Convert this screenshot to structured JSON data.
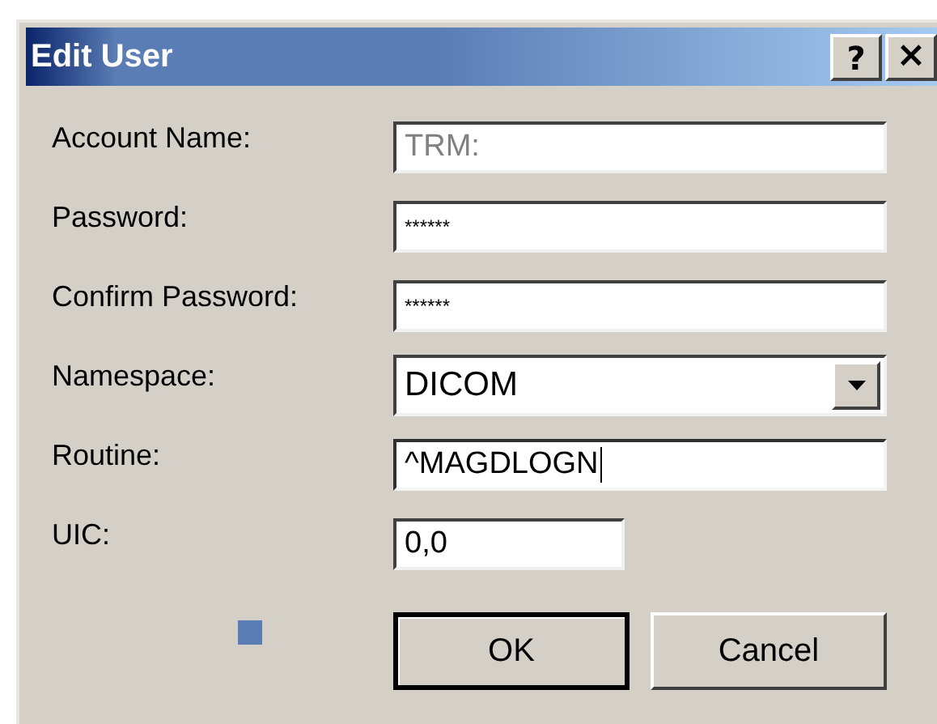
{
  "window": {
    "title": "Edit User",
    "title_buttons": [
      {
        "kind": "help",
        "label": "?"
      },
      {
        "kind": "close",
        "label": "×"
      }
    ]
  },
  "fields": [
    {
      "kind": "text",
      "label": "Account Name:",
      "value": "TRM:",
      "disabled": true,
      "focused": false
    },
    {
      "kind": "password",
      "label": "Password:",
      "value": "******",
      "disabled": false,
      "focused": false
    },
    {
      "kind": "password",
      "label": "Confirm Password:",
      "value": "******",
      "disabled": false,
      "focused": false
    },
    {
      "kind": "combo",
      "label": "Namespace:",
      "value": "DICOM",
      "disabled": false,
      "focused": false
    },
    {
      "kind": "text",
      "label": "Routine:",
      "value": "^MAGDLOGN",
      "disabled": false,
      "focused": true
    },
    {
      "kind": "short",
      "label": "UIC:",
      "value": "0,0",
      "disabled": false,
      "focused": false
    }
  ],
  "buttons": [
    {
      "label": "OK",
      "default": true
    },
    {
      "label": "Cancel",
      "default": false
    }
  ]
}
